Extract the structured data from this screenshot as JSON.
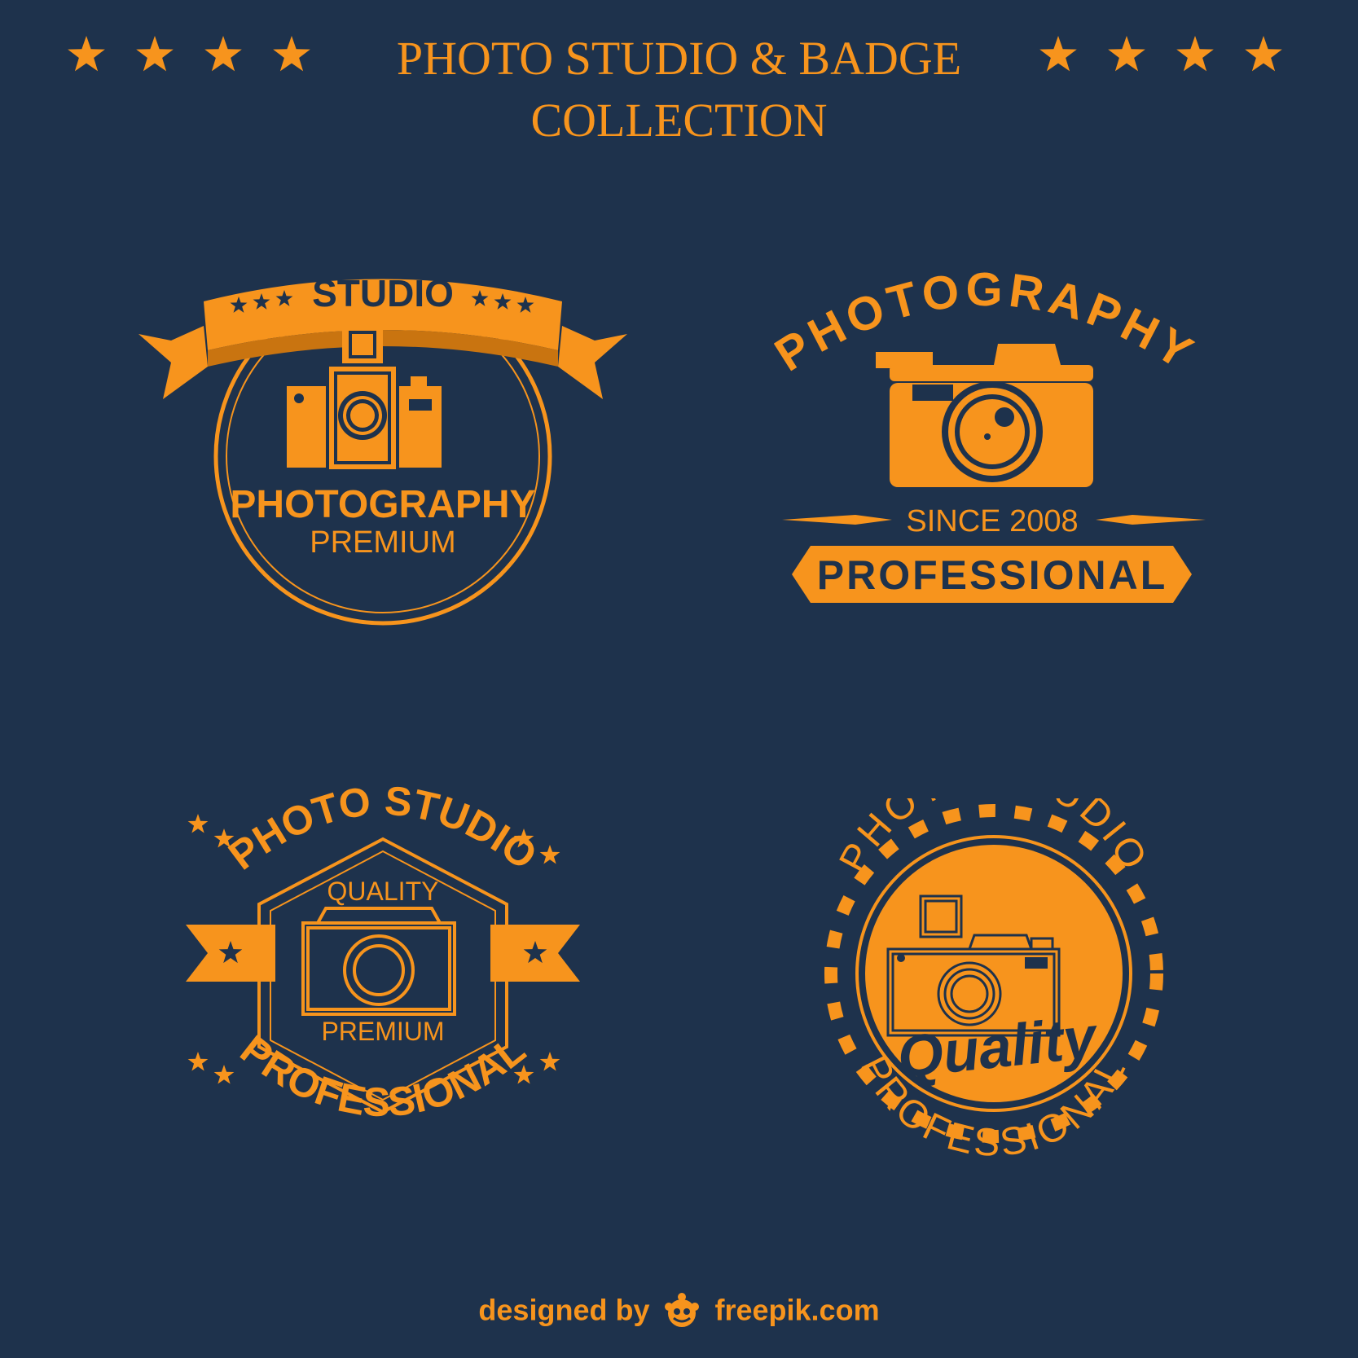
{
  "header": {
    "title_line1": "PHOTO STUDIO & BADGE",
    "title_line2": "COLLECTION"
  },
  "badge1": {
    "ribbon_text": "STUDIO",
    "main_text": "PHOTOGRAPHY",
    "sub_text": "PREMIUM"
  },
  "badge2": {
    "arc_text": "PHOTOGRAPHY",
    "since_text": "SINCE 2008",
    "banner_text": "PROFESSIONAL"
  },
  "badge3": {
    "arc_top_text": "PHOTO STUDIO",
    "top_text": "QUALITY",
    "bottom_text": "PREMIUM",
    "arc_bottom_text": "PROFESSIONAL"
  },
  "badge4": {
    "arc_top_text": "PHOTO STUDIO",
    "script_text": "Quality",
    "arc_bottom_text": "PROFESSIONAL"
  },
  "footer": {
    "designed_by": "designed by",
    "brand": "freepik.com"
  },
  "colors": {
    "background": "#1e324c",
    "accent": "#f7941d"
  },
  "icons": [
    "star-icon",
    "camera-icon",
    "ribbon-banner",
    "freepik-logo-icon"
  ]
}
